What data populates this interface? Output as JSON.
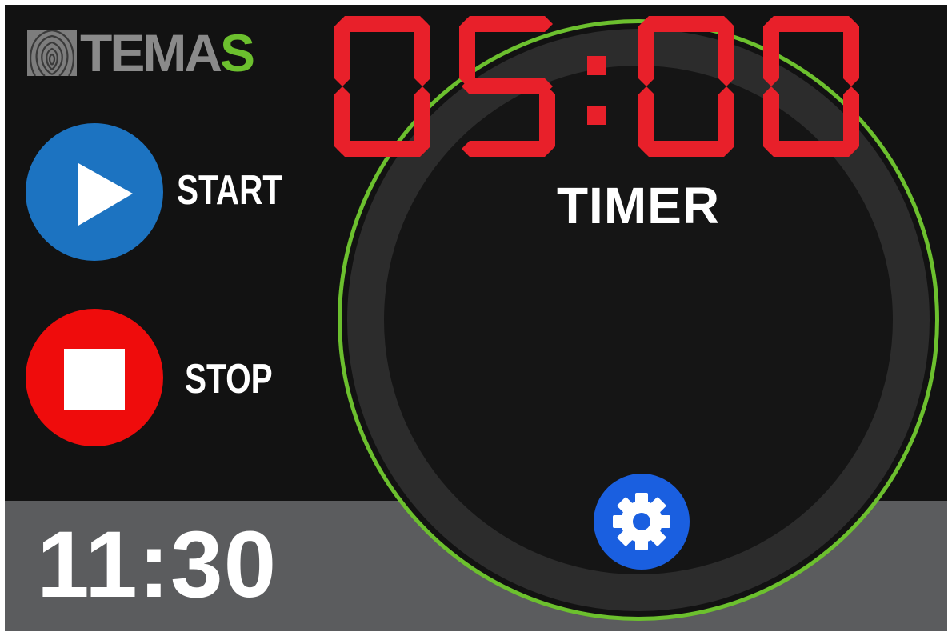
{
  "brand": {
    "name_main": "TEMA",
    "name_accent": "S",
    "icon": "fingerprint-icon",
    "colors": {
      "main": "#8a8a8a",
      "accent": "#6cc02e"
    }
  },
  "controls": {
    "start": {
      "label": "START",
      "icon": "play-icon",
      "color": "#1c73c1"
    },
    "stop": {
      "label": "STOP",
      "icon": "stop-icon",
      "color": "#ef0c0c"
    }
  },
  "timer": {
    "title": "TIMER",
    "value": "05:00",
    "digit_color": "#e8202a",
    "ring_color": "#6cc02e"
  },
  "settings": {
    "icon": "gear-icon",
    "color": "#1a5fe0"
  },
  "clock": {
    "time": "11:30"
  }
}
